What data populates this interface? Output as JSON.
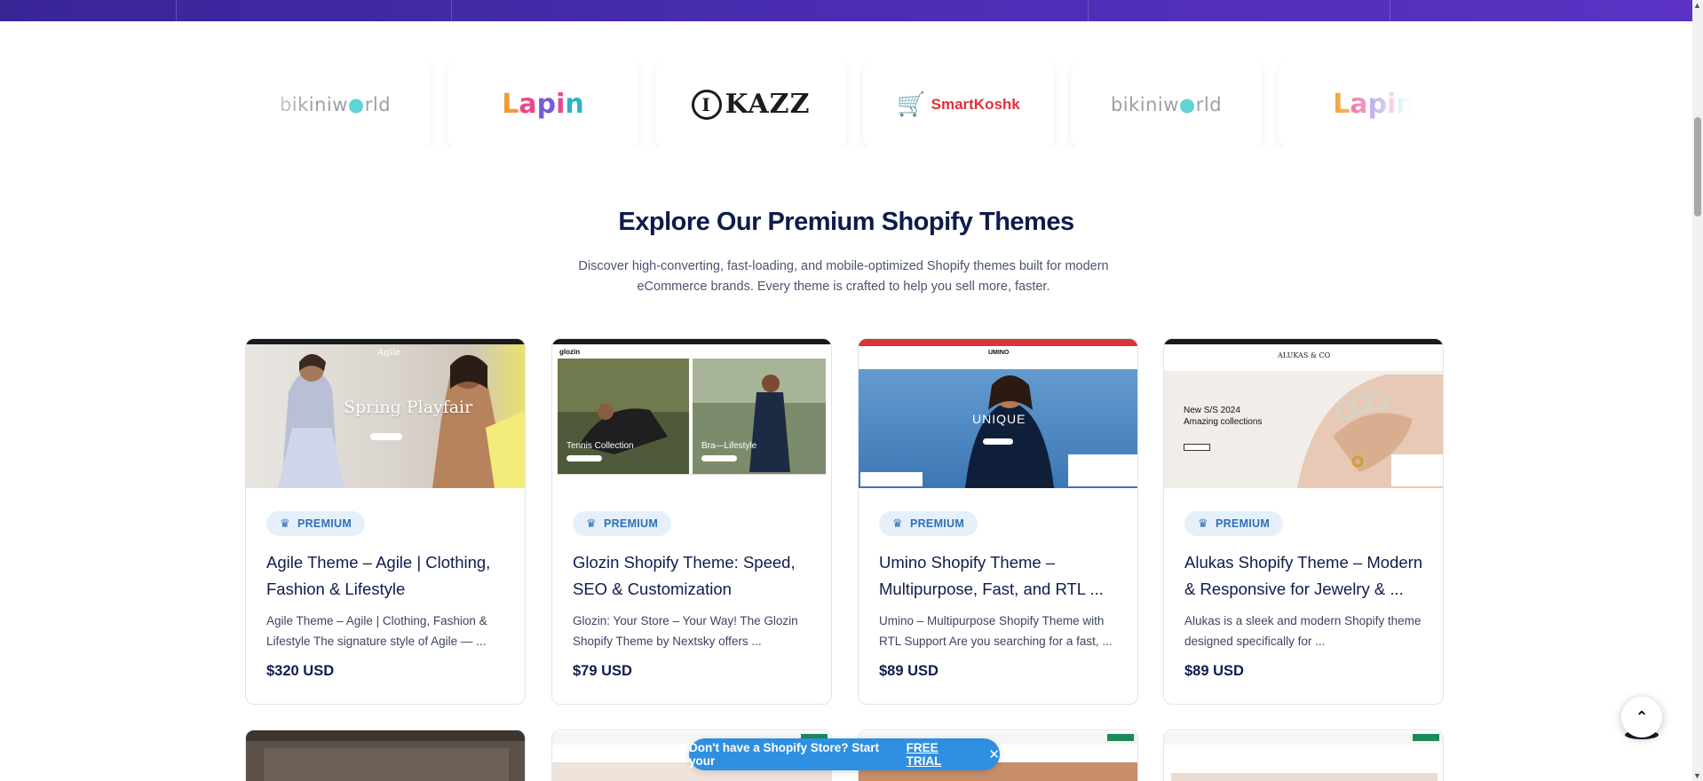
{
  "brand_logos": [
    "bikiniworld",
    "Lapin",
    "IKAZZ",
    "SmartKoshk",
    "bikiniworld",
    "Lapin"
  ],
  "section": {
    "title": "Explore Our Premium Shopify Themes",
    "subtitle": "Discover high-converting, fast-loading, and mobile-optimized Shopify themes built for modern eCommerce brands. Every theme is crafted to help you sell more, faster."
  },
  "themes": [
    {
      "badge": "PREMIUM",
      "title": "Agile Theme – Agile | Clothing, Fashion & Lifestyle",
      "description": "Agile Theme – Agile | Clothing, Fashion & Lifestyle The signature style of Agile — ...",
      "price": "$320 USD",
      "preview": {
        "heading": "Spring Playfair",
        "brand": "Agile"
      }
    },
    {
      "badge": "PREMIUM",
      "title": "Glozin Shopify Theme: Speed, SEO & Customization",
      "description": "Glozin: Your Store – Your Way! The Glozin Shopify Theme by Nextsky offers ...",
      "price": "$79 USD",
      "preview": {
        "brand": "glozin",
        "left": "Tennis Collection",
        "right": "Bra—Lifestyle"
      }
    },
    {
      "badge": "PREMIUM",
      "title": "Umino Shopify Theme – Multipurpose, Fast, and RTL ...",
      "description": "Umino – Multipurpose Shopify Theme with RTL Support Are you searching for a fast, ...",
      "price": "$89 USD",
      "preview": {
        "brand": "UMINO",
        "heading": "UNIQUE"
      }
    },
    {
      "badge": "PREMIUM",
      "title": "Alukas Shopify Theme – Modern & Responsive for Jewelry & ...",
      "description": "Alukas is a sleek and modern Shopify theme designed specifically for ...",
      "price": "$89 USD",
      "preview": {
        "brand": "ALUKAS & CO",
        "heading": "New S/S 2024 Amazing collections"
      }
    }
  ],
  "trial_banner": {
    "text": "Don't have a Shopify Store? Start your",
    "link": "FREE TRIAL",
    "close": "✕"
  },
  "back_to_top": "⌃"
}
